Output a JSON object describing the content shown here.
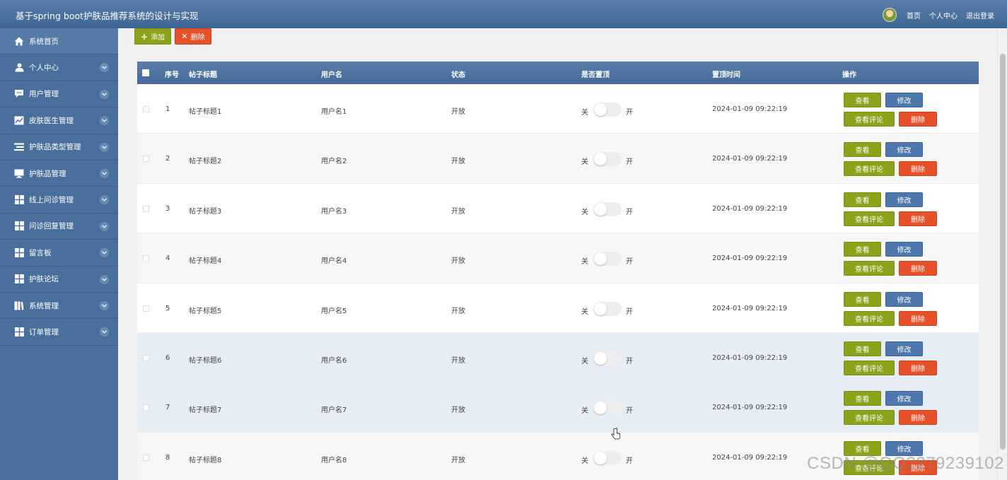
{
  "header": {
    "title": "基于spring boot护肤品推荐系统的设计与实现",
    "links": [
      "首页",
      "个人中心",
      "退出登录"
    ]
  },
  "sidebar": {
    "items": [
      {
        "label": "系统首页",
        "icon": "home-icon",
        "expandable": false
      },
      {
        "label": "个人中心",
        "icon": "user-icon",
        "expandable": true
      },
      {
        "label": "用户管理",
        "icon": "chat-icon",
        "expandable": true
      },
      {
        "label": "皮肤医生管理",
        "icon": "chart-icon",
        "expandable": true
      },
      {
        "label": "护肤品类型管理",
        "icon": "list-icon",
        "expandable": true
      },
      {
        "label": "护肤品管理",
        "icon": "monitor-icon",
        "expandable": true
      },
      {
        "label": "线上问诊管理",
        "icon": "grid-icon",
        "expandable": true
      },
      {
        "label": "问诊回复管理",
        "icon": "grid-icon",
        "expandable": true
      },
      {
        "label": "留言板",
        "icon": "grid-icon",
        "expandable": true
      },
      {
        "label": "护肤论坛",
        "icon": "grid-icon",
        "expandable": true
      },
      {
        "label": "系统管理",
        "icon": "book-icon",
        "expandable": true
      },
      {
        "label": "订单管理",
        "icon": "grid-icon",
        "expandable": true
      }
    ]
  },
  "toolbar": {
    "add_label": "添加",
    "delete_label": "删除"
  },
  "table": {
    "columns": [
      "序号",
      "帖子标题",
      "用户名",
      "状态",
      "是否置顶",
      "置顶时间",
      "操作"
    ],
    "switch_off": "关",
    "switch_on": "开",
    "actions": {
      "view": "查看",
      "edit": "修改",
      "comments": "查看评论",
      "delete": "删除"
    },
    "rows": [
      {
        "no": "1",
        "title": "帖子标题1",
        "user": "用户名1",
        "status": "开放",
        "time": "2024-01-09 09:22:19"
      },
      {
        "no": "2",
        "title": "帖子标题2",
        "user": "用户名2",
        "status": "开放",
        "time": "2024-01-09 09:22:19"
      },
      {
        "no": "3",
        "title": "帖子标题3",
        "user": "用户名3",
        "status": "开放",
        "time": "2024-01-09 09:22:19"
      },
      {
        "no": "4",
        "title": "帖子标题4",
        "user": "用户名4",
        "status": "开放",
        "time": "2024-01-09 09:22:19"
      },
      {
        "no": "5",
        "title": "帖子标题5",
        "user": "用户名5",
        "status": "开放",
        "time": "2024-01-09 09:22:19"
      },
      {
        "no": "6",
        "title": "帖子标题6",
        "user": "用户名6",
        "status": "开放",
        "time": "2024-01-09 09:22:19"
      },
      {
        "no": "7",
        "title": "帖子标题7",
        "user": "用户名7",
        "status": "开放",
        "time": "2024-01-09 09:22:19"
      },
      {
        "no": "8",
        "title": "帖子标题8",
        "user": "用户名8",
        "status": "开放",
        "time": "2024-01-09 09:22:19"
      }
    ]
  },
  "watermark": "CSDN @QQ2279239102",
  "colors": {
    "header": "#46699a",
    "sidebar": "#4a6f9d",
    "olive": "#8aa31a",
    "red": "#e6512a",
    "blue": "#4e77ad"
  }
}
